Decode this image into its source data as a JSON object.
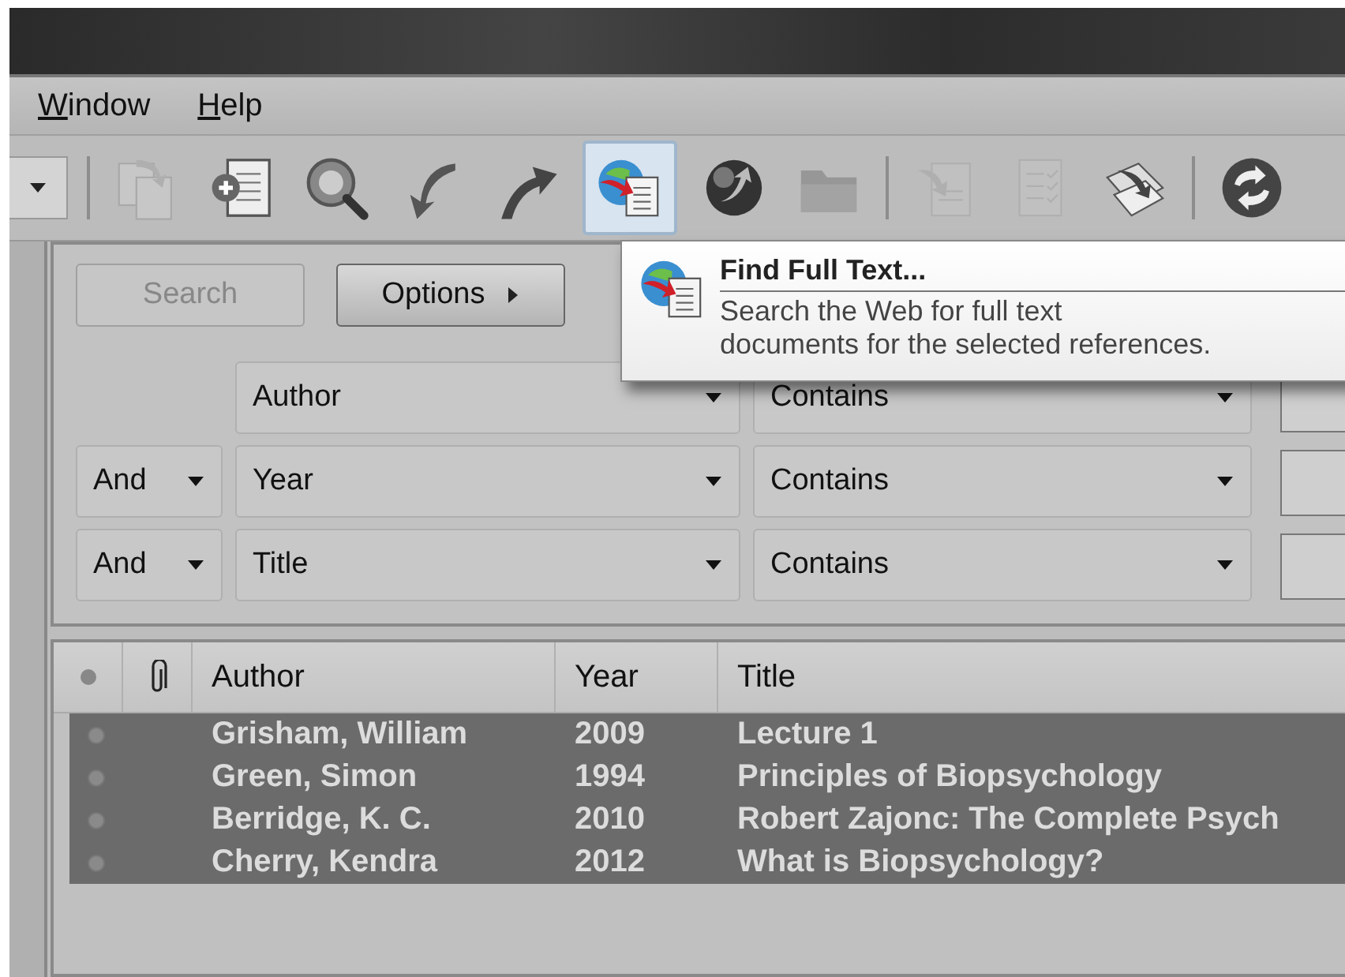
{
  "menu": [
    {
      "label": "Window"
    },
    {
      "label": "Help"
    }
  ],
  "toolbar": [
    {
      "kind": "copy",
      "disabled": true,
      "highlighted": false
    },
    {
      "kind": "new",
      "disabled": false,
      "highlighted": false
    },
    {
      "kind": "find",
      "disabled": false,
      "highlighted": false
    },
    {
      "kind": "back",
      "disabled": false,
      "highlighted": false
    },
    {
      "kind": "up",
      "disabled": false,
      "highlighted": false
    },
    {
      "kind": "fulltext",
      "disabled": false,
      "highlighted": true
    },
    {
      "kind": "online",
      "disabled": false,
      "highlighted": false
    },
    {
      "kind": "folder",
      "disabled": true,
      "highlighted": false
    },
    {
      "kind": "separator"
    },
    {
      "kind": "import",
      "disabled": true,
      "highlighted": false
    },
    {
      "kind": "checklist",
      "disabled": true,
      "highlighted": false
    },
    {
      "kind": "export",
      "disabled": false,
      "highlighted": false
    },
    {
      "kind": "separator"
    },
    {
      "kind": "sync",
      "disabled": false,
      "highlighted": false
    }
  ],
  "tooltip": {
    "title": "Find Full Text...",
    "description": "Search the Web for full text\ndocuments for the selected references."
  },
  "search": {
    "search_button": {
      "label": "Search",
      "disabled": true
    },
    "options_button": {
      "label": "Options"
    },
    "rows": [
      {
        "field": "Author",
        "operator": "Contains"
      },
      {
        "connector": "And",
        "field": "Year",
        "operator": "Contains"
      },
      {
        "connector": "And",
        "field": "Title",
        "operator": "Contains"
      }
    ]
  },
  "table": {
    "columns": [
      "Author",
      "Year",
      "Title"
    ],
    "rows": [
      {
        "author": "Grisham, William",
        "year": "2009",
        "title": "Lecture 1",
        "selected": true
      },
      {
        "author": "Green, Simon",
        "year": "1994",
        "title": "Principles of Biopsychology",
        "selected": true
      },
      {
        "author": "Berridge, K. C.",
        "year": "2010",
        "title": "Robert Zajonc: The Complete Psych",
        "selected": true
      },
      {
        "author": "Cherry, Kendra",
        "year": "2012",
        "title": "What is Biopsychology?",
        "selected": true
      }
    ]
  }
}
